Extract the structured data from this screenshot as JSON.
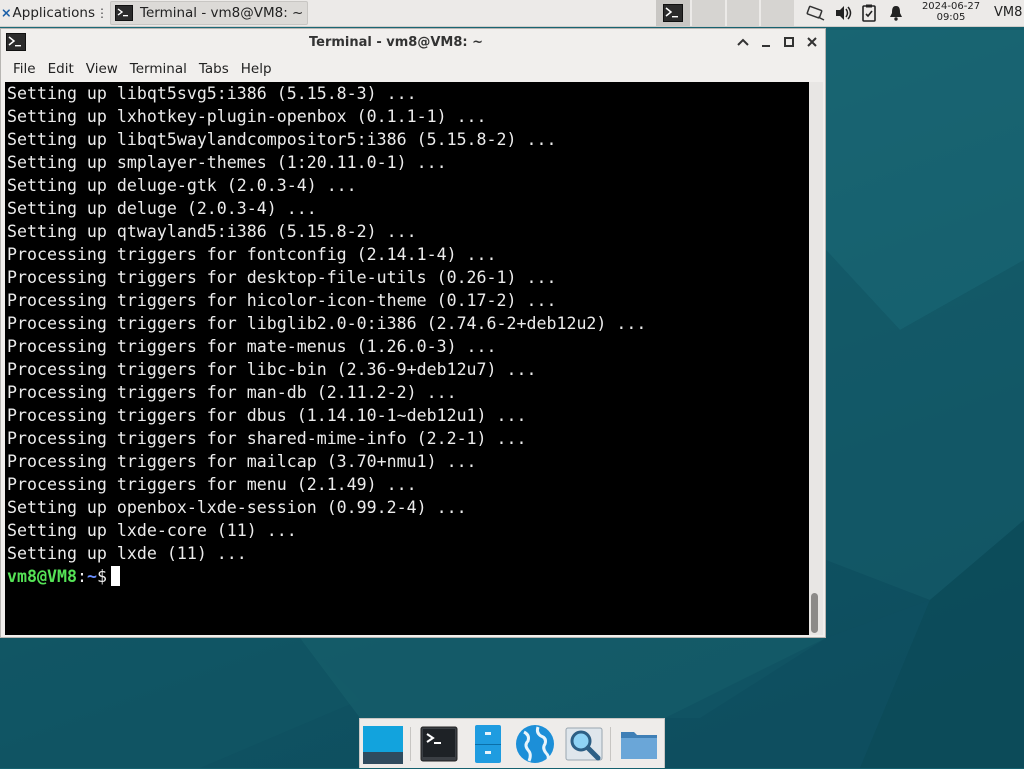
{
  "top_panel": {
    "applications_label": "Applications",
    "taskbar_item_title": "Terminal - vm8@VM8: ~",
    "clock_date": "2024-06-27",
    "clock_time": "09:05",
    "hostname": "VM8"
  },
  "window": {
    "title": "Terminal - vm8@VM8: ~",
    "menu": [
      "File",
      "Edit",
      "View",
      "Terminal",
      "Tabs",
      "Help"
    ]
  },
  "terminal": {
    "lines": [
      "Setting up libqt5svg5:i386 (5.15.8-3) ...",
      "Setting up lxhotkey-plugin-openbox (0.1.1-1) ...",
      "Setting up libqt5waylandcompositor5:i386 (5.15.8-2) ...",
      "Setting up smplayer-themes (1:20.11.0-1) ...",
      "Setting up deluge-gtk (2.0.3-4) ...",
      "Setting up deluge (2.0.3-4) ...",
      "Setting up qtwayland5:i386 (5.15.8-2) ...",
      "Processing triggers for fontconfig (2.14.1-4) ...",
      "Processing triggers for desktop-file-utils (0.26-1) ...",
      "Processing triggers for hicolor-icon-theme (0.17-2) ...",
      "Processing triggers for libglib2.0-0:i386 (2.74.6-2+deb12u2) ...",
      "Processing triggers for mate-menus (1.26.0-3) ...",
      "Processing triggers for libc-bin (2.36-9+deb12u7) ...",
      "Processing triggers for man-db (2.11.2-2) ...",
      "Processing triggers for dbus (1.14.10-1~deb12u1) ...",
      "Processing triggers for shared-mime-info (2.2-1) ...",
      "Processing triggers for mailcap (3.70+nmu1) ...",
      "Processing triggers for menu (2.1.49) ...",
      "Setting up openbox-lxde-session (0.99.2-4) ...",
      "Setting up lxde-core (11) ...",
      "Setting up lxde (11) ..."
    ],
    "prompt_user": "vm8@VM8",
    "prompt_sep": ":",
    "prompt_path": "~",
    "prompt_symbol": "$"
  },
  "dock": {
    "items": [
      "show-desktop-icon",
      "terminal-icon",
      "file-cabinet-icon",
      "web-browser-icon",
      "app-finder-icon",
      "folder-icon"
    ]
  },
  "colors": {
    "terminal_bg": "#000000",
    "prompt_user": "#55e356",
    "prompt_path": "#6b8fff",
    "desktop_bg": "#15606e"
  }
}
